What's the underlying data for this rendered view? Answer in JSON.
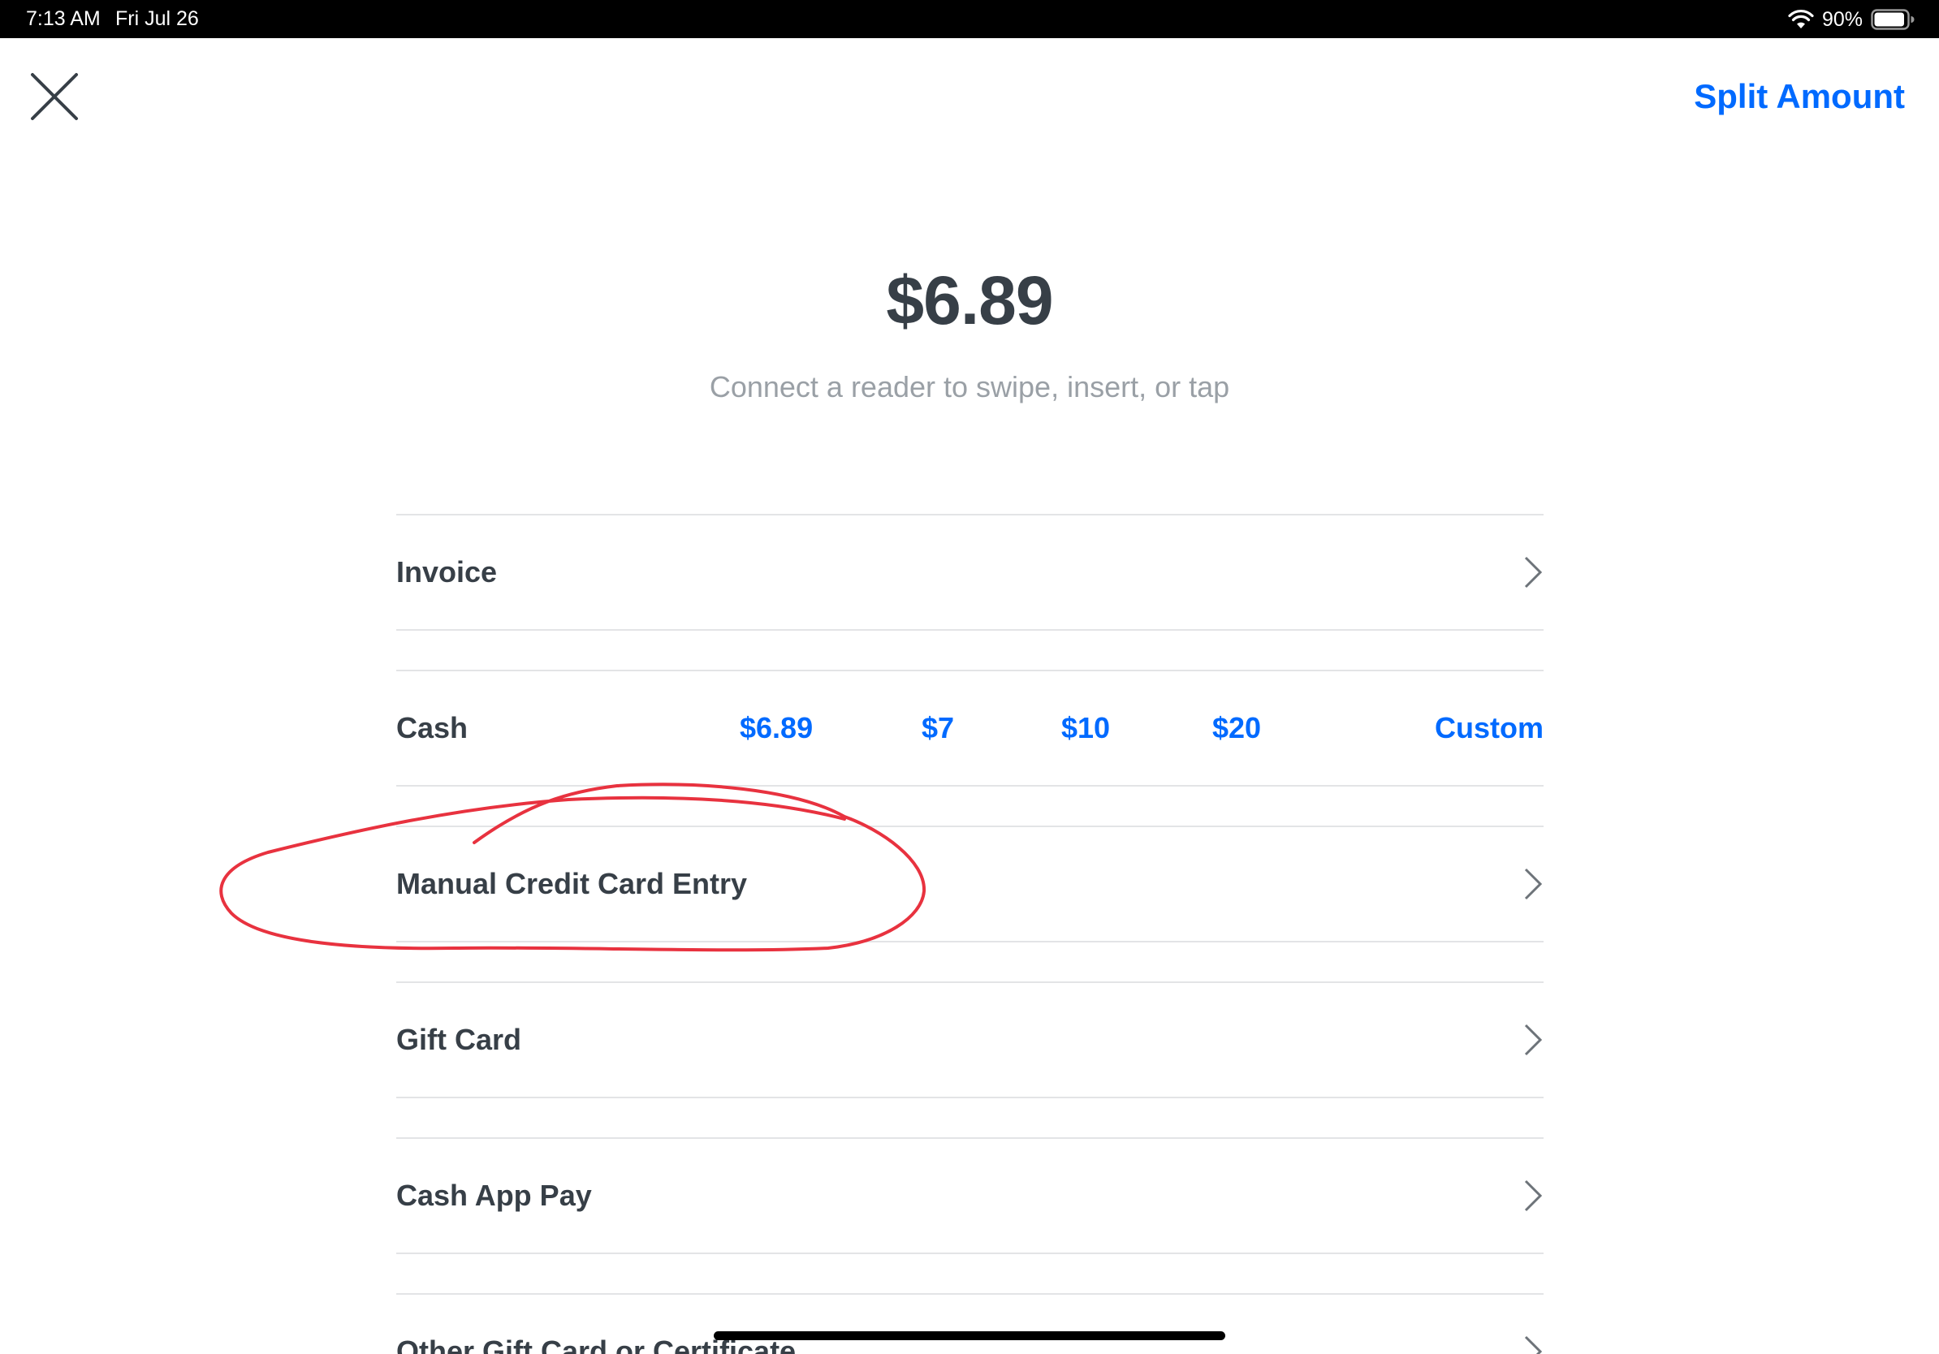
{
  "status_bar": {
    "time": "7:13 AM",
    "date": "Fri Jul 26",
    "battery_percent": "90%"
  },
  "header": {
    "close_icon": "close-icon",
    "split_amount_label": "Split Amount"
  },
  "payment": {
    "amount": "$6.89",
    "subtitle": "Connect a reader to swipe, insert, or tap"
  },
  "rows": {
    "invoice": "Invoice",
    "cash": "Cash",
    "manual_entry": "Manual Credit Card Entry",
    "gift_card": "Gift Card",
    "cash_app_pay": "Cash App Pay",
    "other_gift_card": "Other Gift Card or Certificate"
  },
  "cash_options": [
    "$6.89",
    "$7",
    "$10",
    "$20",
    "Custom"
  ],
  "colors": {
    "accent": "#006aff",
    "text": "#373f47",
    "muted": "#9aa0a6",
    "annotation": "#e8323f"
  }
}
